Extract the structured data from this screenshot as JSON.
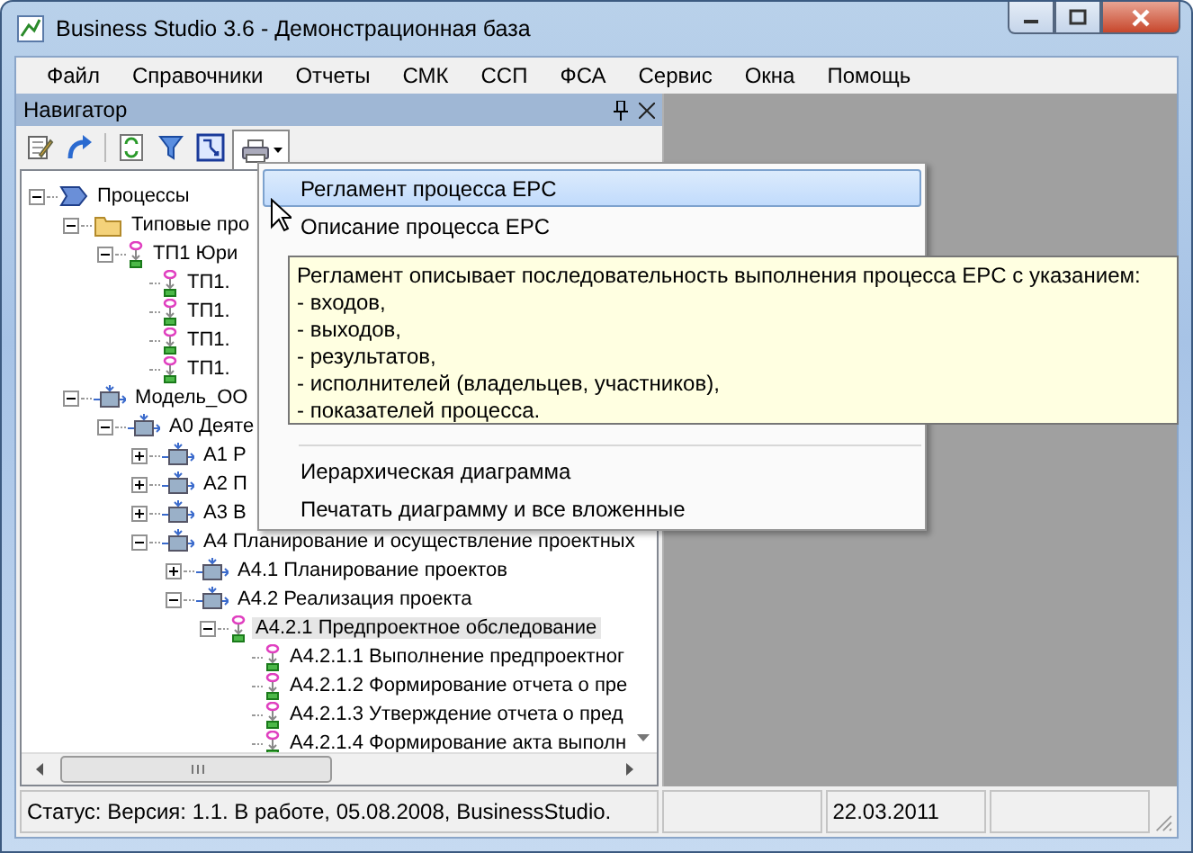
{
  "window": {
    "title": "Business Studio 3.6 - Демонстрационная база"
  },
  "menubar": [
    "Файл",
    "Справочники",
    "Отчеты",
    "СМК",
    "ССП",
    "ФСА",
    "Сервис",
    "Окна",
    "Помощь"
  ],
  "navigator": {
    "title": "Навигатор",
    "tree": [
      {
        "label": "Процессы",
        "kind": "process-group",
        "expanded": true,
        "selected": false,
        "children": [
          {
            "label": "Типовые про",
            "kind": "folder",
            "expanded": true,
            "selected": false,
            "children": [
              {
                "label": "ТП1 Юри",
                "kind": "function",
                "expanded": true,
                "selected": false,
                "children": [
                  {
                    "label": "ТП1.",
                    "kind": "function",
                    "selected": false
                  },
                  {
                    "label": "ТП1.",
                    "kind": "function",
                    "selected": false
                  },
                  {
                    "label": "ТП1.",
                    "kind": "function",
                    "selected": false
                  },
                  {
                    "label": "ТП1.",
                    "kind": "function",
                    "selected": false
                  }
                ]
              }
            ]
          },
          {
            "label": "Модель_ОО",
            "kind": "model",
            "expanded": true,
            "selected": false,
            "children": [
              {
                "label": "А0 Деяте",
                "kind": "model",
                "expanded": true,
                "selected": false,
                "children": [
                  {
                    "label": "А1 Р",
                    "kind": "model",
                    "expanded": false,
                    "selected": false
                  },
                  {
                    "label": "А2 П",
                    "kind": "model",
                    "expanded": false,
                    "selected": false
                  },
                  {
                    "label": "А3 В",
                    "kind": "model",
                    "expanded": false,
                    "selected": false
                  },
                  {
                    "label": "А4 Планирование и осуществление проектных",
                    "kind": "model",
                    "expanded": true,
                    "selected": false,
                    "children": [
                      {
                        "label": "А4.1 Планирование проектов",
                        "kind": "model",
                        "expanded": false,
                        "selected": false
                      },
                      {
                        "label": "А4.2 Реализация проекта",
                        "kind": "model",
                        "expanded": true,
                        "selected": false,
                        "children": [
                          {
                            "label": "А4.2.1 Предпроектное обследование",
                            "kind": "function",
                            "expanded": true,
                            "selected": true,
                            "children": [
                              {
                                "label": "А4.2.1.1 Выполнение предпроектног",
                                "kind": "function",
                                "selected": false
                              },
                              {
                                "label": "А4.2.1.2 Формирование отчета о пре",
                                "kind": "function",
                                "selected": false
                              },
                              {
                                "label": "А4.2.1.3 Утверждение отчета о пред",
                                "kind": "function",
                                "selected": false
                              },
                              {
                                "label": "А4.2.1.4 Формирование акта выполн",
                                "kind": "function",
                                "selected": false
                              }
                            ]
                          }
                        ]
                      }
                    ]
                  }
                ]
              }
            ]
          }
        ]
      }
    ]
  },
  "print_menu": {
    "items": [
      {
        "kind": "item",
        "label": "Регламент процесса EPC",
        "selected": true
      },
      {
        "kind": "item",
        "label": "Описание процесса EPC",
        "selected": false
      },
      {
        "kind": "spacer"
      },
      {
        "kind": "separator"
      },
      {
        "kind": "item",
        "label": "Иерархическая диаграмма",
        "selected": false
      },
      {
        "kind": "item",
        "label": "Печатать диаграмму и все вложенные",
        "selected": false
      }
    ]
  },
  "tooltip": {
    "lines": [
      "Регламент описывает последовательность выполнения процесса EPC с указанием:",
      "- входов,",
      "- выходов,",
      "- результатов,",
      "- исполнителей (владельцев, участников),",
      "- показателей процесса."
    ]
  },
  "status_bar": [
    "Статус: Версия: 1.1. В работе, 05.08.2008, BusinessStudio.",
    "22.03.2011"
  ]
}
